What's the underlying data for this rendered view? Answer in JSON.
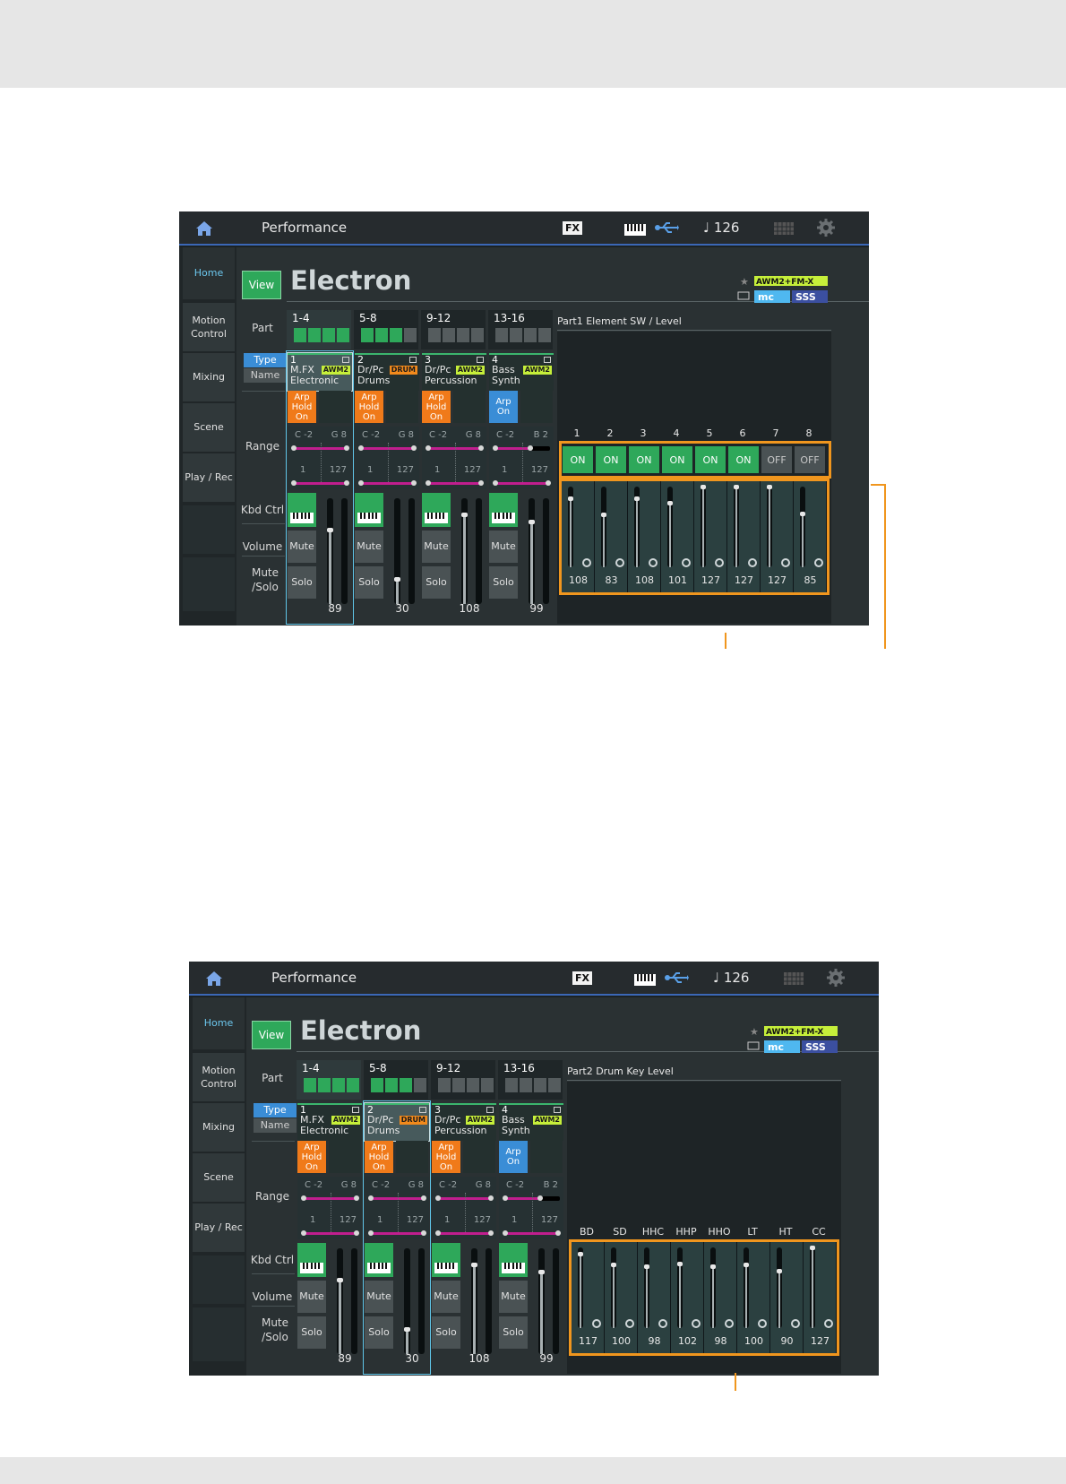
{
  "screens": [
    {
      "topbar": {
        "title": "Performance",
        "fx": "FX",
        "tempo": "♩ 126"
      },
      "sidebar": [
        "Home",
        "Motion Control",
        "Mixing",
        "Scene",
        "Play / Rec"
      ],
      "view_label": "View",
      "performance_name": "Electron",
      "part_label": "Part",
      "type_label": "Type",
      "name_label": "Name",
      "range_label": "Range",
      "kbd_label": "Kbd Ctrl",
      "volume_label": "Volume",
      "mute_solo_label": "Mute /Solo",
      "groups": [
        "1-4",
        "5-8",
        "9-12",
        "13-16"
      ],
      "selected_part": 1,
      "parts": [
        {
          "num": "1",
          "cat": "M.FX",
          "sub": "Electronic",
          "badge": "AWM2",
          "arp": "Arp Hold On",
          "note_lo": "C -2",
          "note_hi": "G 8",
          "vel_lo": "1",
          "vel_hi": "127",
          "mute": "Mute",
          "solo": "Solo",
          "volume": "89"
        },
        {
          "num": "2",
          "cat": "Dr/Pc",
          "sub": "Drums",
          "badge": "DRUM",
          "arp": "Arp Hold On",
          "note_lo": "C -2",
          "note_hi": "G 8",
          "vel_lo": "1",
          "vel_hi": "127",
          "mute": "Mute",
          "solo": "Solo",
          "volume": "30"
        },
        {
          "num": "3",
          "cat": "Dr/Pc",
          "sub": "Percussion",
          "badge": "AWM2",
          "arp": "Arp Hold On",
          "note_lo": "C -2",
          "note_hi": "G 8",
          "vel_lo": "1",
          "vel_hi": "127",
          "mute": "Mute",
          "solo": "Solo",
          "volume": "108"
        },
        {
          "num": "4",
          "cat": "Bass",
          "sub": "Synth",
          "badge": "AWM2",
          "arp": "Arp On",
          "note_lo": "C -2",
          "note_hi": "B 2",
          "vel_lo": "1",
          "vel_hi": "127",
          "mute": "Mute",
          "solo": "Solo",
          "volume": "99"
        }
      ],
      "right_panel": {
        "title": "Part1 Element SW / Level",
        "labels": [
          "1",
          "2",
          "3",
          "4",
          "5",
          "6",
          "7",
          "8"
        ],
        "switches": [
          "ON",
          "ON",
          "ON",
          "ON",
          "ON",
          "ON",
          "OFF",
          "OFF"
        ],
        "levels": [
          "108",
          "83",
          "108",
          "101",
          "127",
          "127",
          "127",
          "85"
        ]
      }
    },
    {
      "topbar": {
        "title": "Performance",
        "fx": "FX",
        "tempo": "♩ 126"
      },
      "sidebar": [
        "Home",
        "Motion Control",
        "Mixing",
        "Scene",
        "Play / Rec"
      ],
      "view_label": "View",
      "performance_name": "Electron",
      "part_label": "Part",
      "type_label": "Type",
      "name_label": "Name",
      "range_label": "Range",
      "kbd_label": "Kbd Ctrl",
      "volume_label": "Volume",
      "mute_solo_label": "Mute /Solo",
      "groups": [
        "1-4",
        "5-8",
        "9-12",
        "13-16"
      ],
      "selected_part": 2,
      "parts": [
        {
          "num": "1",
          "cat": "M.FX",
          "sub": "Electronic",
          "badge": "AWM2",
          "arp": "Arp Hold On",
          "note_lo": "C -2",
          "note_hi": "G 8",
          "vel_lo": "1",
          "vel_hi": "127",
          "mute": "Mute",
          "solo": "Solo",
          "volume": "89"
        },
        {
          "num": "2",
          "cat": "Dr/Pc",
          "sub": "Drums",
          "badge": "DRUM",
          "arp": "Arp Hold On",
          "note_lo": "C -2",
          "note_hi": "G 8",
          "vel_lo": "1",
          "vel_hi": "127",
          "mute": "Mute",
          "solo": "Solo",
          "volume": "30"
        },
        {
          "num": "3",
          "cat": "Dr/Pc",
          "sub": "Percussion",
          "badge": "AWM2",
          "arp": "Arp Hold On",
          "note_lo": "C -2",
          "note_hi": "G 8",
          "vel_lo": "1",
          "vel_hi": "127",
          "mute": "Mute",
          "solo": "Solo",
          "volume": "108"
        },
        {
          "num": "4",
          "cat": "Bass",
          "sub": "Synth",
          "badge": "AWM2",
          "arp": "Arp On",
          "note_lo": "C -2",
          "note_hi": "B 2",
          "vel_lo": "1",
          "vel_hi": "127",
          "mute": "Mute",
          "solo": "Solo",
          "volume": "99"
        }
      ],
      "right_panel": {
        "title": "Part2 Drum Key Level",
        "labels": [
          "BD",
          "SD",
          "HHC",
          "HHP",
          "HHO",
          "LT",
          "HT",
          "CC"
        ],
        "switches": [],
        "levels": [
          "117",
          "100",
          "98",
          "102",
          "98",
          "100",
          "90",
          "127"
        ]
      }
    }
  ]
}
